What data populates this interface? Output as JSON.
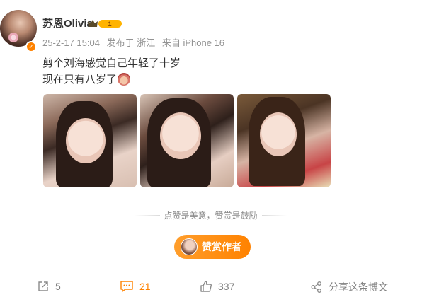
{
  "post": {
    "author": "苏恩Olivia",
    "vip_level": "1",
    "date": "25-2-17 15:04",
    "published_in": "发布于 浙江",
    "device": "来自 iPhone 16",
    "text_line1": "剪个刘海感觉自己年轻了十岁",
    "text_line2": "现在只有八岁了"
  },
  "reward": {
    "slogan": "点赞是美意，赞赏是鼓励",
    "button_label": "赞赏作者"
  },
  "actions": {
    "repost_count": "5",
    "comment_count": "21",
    "like_count": "337",
    "share_label": "分享这条博文"
  },
  "colors": {
    "accent": "#ff8200",
    "meta_text": "#939393",
    "body_text": "#333333"
  },
  "icons": [
    "verified-badge-icon",
    "vip-crown-icon",
    "rabbit-emoji-icon",
    "repost-icon",
    "comment-icon",
    "like-icon",
    "share-icon"
  ]
}
